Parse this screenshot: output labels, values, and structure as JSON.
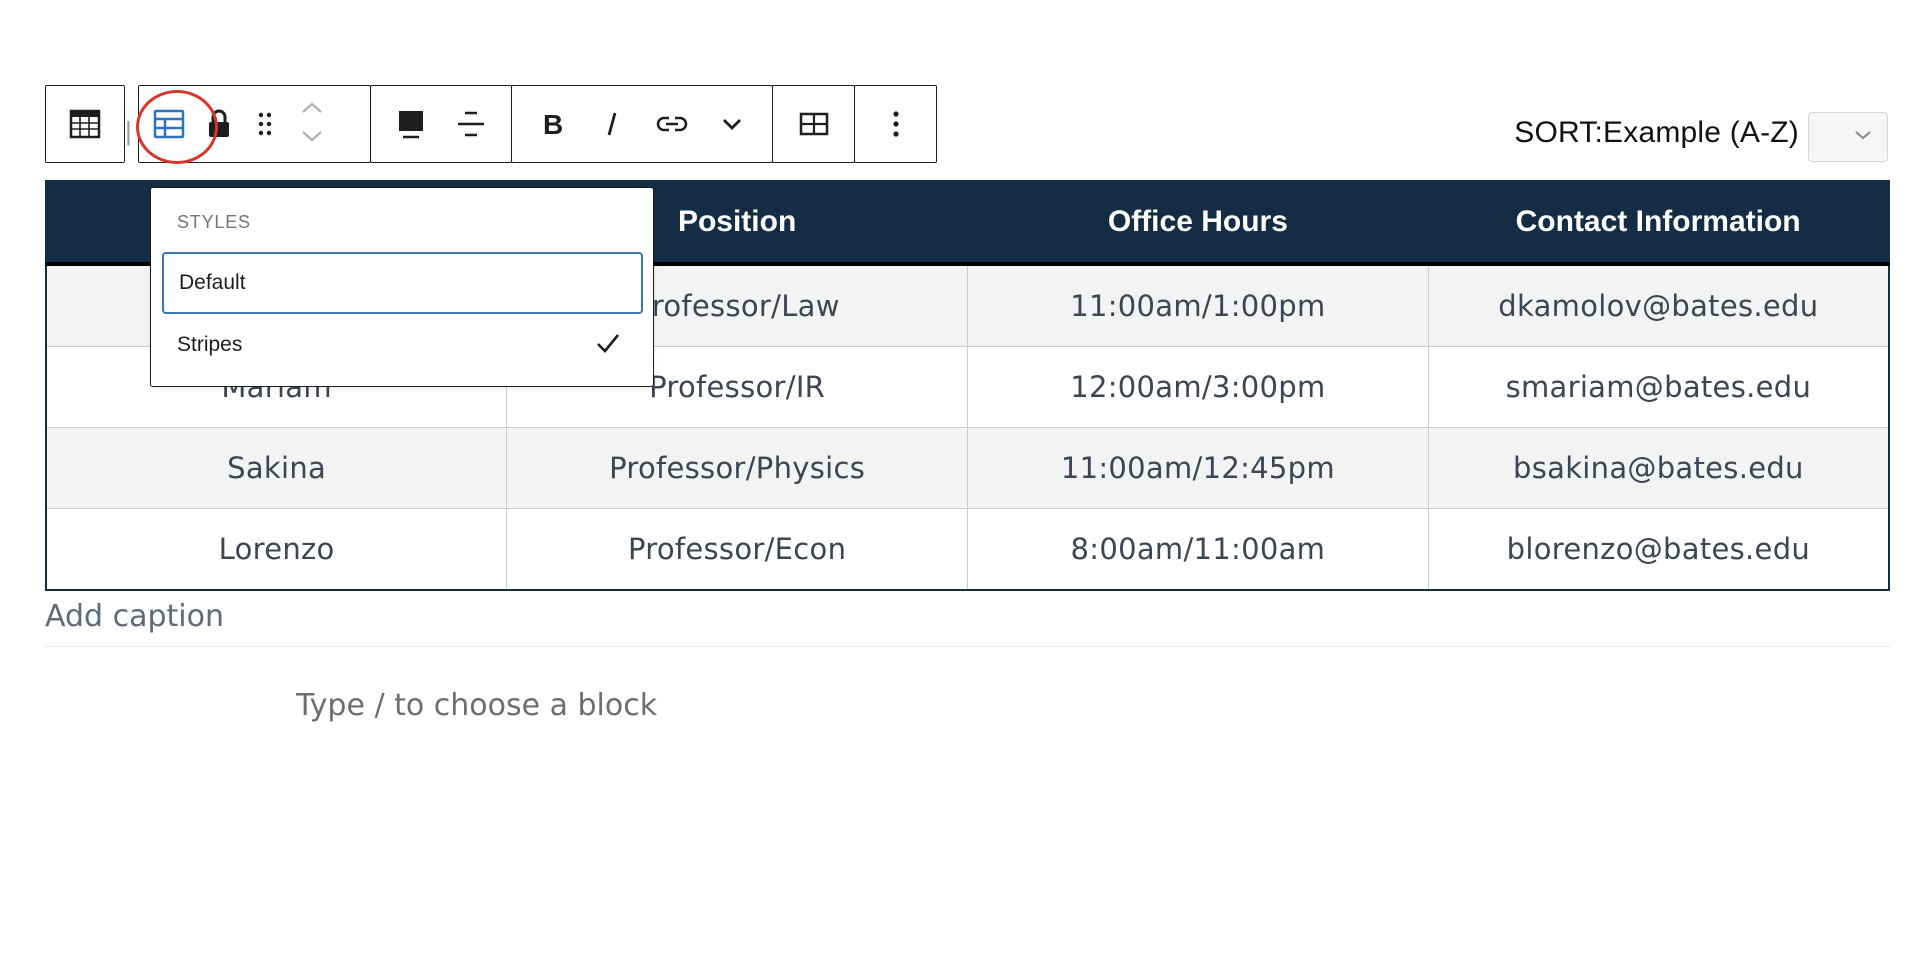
{
  "toolbar": {
    "buttons": [
      {
        "name": "table-block-icon"
      },
      {
        "name": "table-style-icon"
      },
      {
        "name": "lock-icon"
      },
      {
        "name": "drag-handle-icon"
      },
      {
        "name": "move-up-icon"
      },
      {
        "name": "move-down-icon"
      },
      {
        "name": "align-icon"
      },
      {
        "name": "justify-icon"
      },
      {
        "name": "bold-icon"
      },
      {
        "name": "italic-icon"
      },
      {
        "name": "link-icon"
      },
      {
        "name": "more-formatting-icon"
      },
      {
        "name": "edit-table-icon"
      },
      {
        "name": "options-icon"
      }
    ]
  },
  "sort": {
    "label": "SORT:Example (A-Z)"
  },
  "styles_popover": {
    "title": "STYLES",
    "options": [
      "Default",
      "Stripes"
    ],
    "checked": "Stripes",
    "focused": "Default"
  },
  "table": {
    "headers": [
      "",
      "Position",
      "Office Hours",
      "Contact Information"
    ],
    "rows": [
      [
        "",
        "Professor/Law",
        "11:00am/1:00pm",
        "dkamolov@bates.edu"
      ],
      [
        "Mariam",
        "Professor/IR",
        "12:00am/3:00pm",
        "smariam@bates.edu"
      ],
      [
        "Sakina",
        "Professor/Physics",
        "11:00am/12:45pm",
        "bsakina@bates.edu"
      ],
      [
        "Lorenzo",
        "Professor/Econ",
        "8:00am/11:00am",
        "blorenzo@bates.edu"
      ]
    ],
    "caption_placeholder": "Add caption"
  },
  "appender": {
    "placeholder": "Type / to choose a block"
  },
  "colors": {
    "header_bg": "#142d45",
    "stripe_bg": "#f3f3f3",
    "focus_border": "#3a78b5",
    "annotation_ring": "#d9362b"
  }
}
